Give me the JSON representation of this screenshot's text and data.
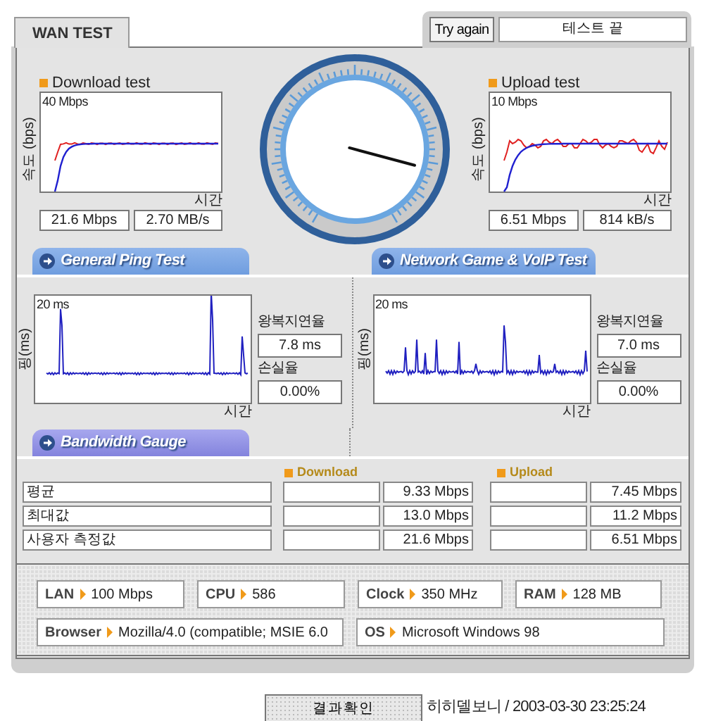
{
  "tabs": [
    {
      "label": "WAN TEST"
    }
  ],
  "try_again_button": "Try again",
  "status_field": "테스트 끝",
  "download_test": {
    "title": "Download test",
    "axis_label": "속도 (bps)",
    "scale_label": "40 Mbps",
    "time_label": "시간",
    "readings": [
      "21.6 Mbps",
      "2.70 MB/s"
    ]
  },
  "upload_test": {
    "title": "Upload test",
    "axis_label": "속도 (bps)",
    "scale_label": "10 Mbps",
    "time_label": "시간",
    "readings": [
      "6.51 Mbps",
      "814 kB/s"
    ]
  },
  "ping_sections": [
    {
      "tab": "General Ping Test",
      "axis_label": "핑(ms)",
      "scale_label": "20 ms",
      "time_label": "시간",
      "latency_label": "왕복지연율",
      "latency": "7.8 ms",
      "loss_label": "손실율",
      "loss": "0.00%"
    },
    {
      "tab": "Network Game & VoIP Test",
      "axis_label": "핑(ms)",
      "scale_label": "20 ms",
      "time_label": "시간",
      "latency_label": "왕복지연율",
      "latency": "7.0 ms",
      "loss_label": "손실율",
      "loss": "0.00%"
    }
  ],
  "bandwidth_tab": "Bandwidth Gauge",
  "bandwidth": {
    "columns": [
      "Download",
      "Upload"
    ],
    "rows": [
      {
        "label": "평균",
        "download": "9.33 Mbps",
        "upload": "7.45 Mbps"
      },
      {
        "label": "최대값",
        "download": "13.0 Mbps",
        "upload": "11.2 Mbps"
      },
      {
        "label": "사용자 측정값",
        "download": "21.6 Mbps",
        "upload": "6.51 Mbps"
      }
    ]
  },
  "system_info": [
    {
      "label": "LAN",
      "value": "100 Mbps"
    },
    {
      "label": "CPU",
      "value": "586"
    },
    {
      "label": "Clock",
      "value": "350 MHz"
    },
    {
      "label": "RAM",
      "value": "128 MB"
    },
    {
      "label": "Browser",
      "value": "Mozilla/4.0 (compatible; MSIE 6.0"
    },
    {
      "label": "OS",
      "value": "Microsoft Windows 98"
    }
  ],
  "result_button": "결과확인",
  "footer": "히히델보니 / 2003-03-30 23:25:24"
}
